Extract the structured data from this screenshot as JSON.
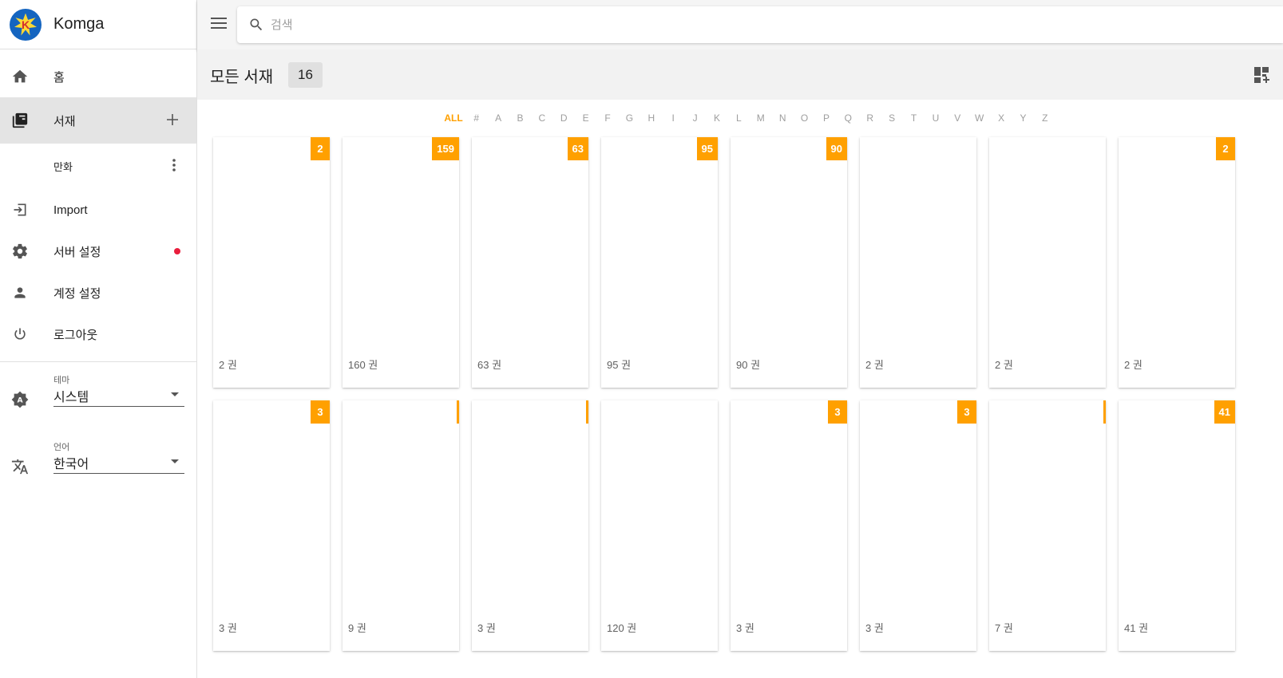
{
  "app": {
    "name": "Komga"
  },
  "nav": {
    "home": "홈",
    "libraries": "서재",
    "library_sub": "만화",
    "import": "Import",
    "server_settings": "서버 설정",
    "account_settings": "계정 설정",
    "logout": "로그아웃"
  },
  "theme": {
    "caption": "테마",
    "value": "시스템"
  },
  "language": {
    "caption": "언어",
    "value": "한국어"
  },
  "search": {
    "placeholder": "검색"
  },
  "header": {
    "title": "모든 서재",
    "count": "16"
  },
  "alphabet": [
    "ALL",
    "#",
    "A",
    "B",
    "C",
    "D",
    "E",
    "F",
    "G",
    "H",
    "I",
    "J",
    "K",
    "L",
    "M",
    "N",
    "O",
    "P",
    "Q",
    "R",
    "S",
    "T",
    "U",
    "V",
    "W",
    "X",
    "Y",
    "Z"
  ],
  "series_cards": [
    {
      "badge": "2",
      "volumes": "2 권"
    },
    {
      "badge": "159",
      "volumes": "160 권"
    },
    {
      "badge": "63",
      "volumes": "63 권"
    },
    {
      "badge": "95",
      "volumes": "95 권"
    },
    {
      "badge": "90",
      "volumes": "90 권"
    },
    {
      "badge": "",
      "volumes": "2 권"
    },
    {
      "badge": "",
      "volumes": "2 권"
    },
    {
      "badge": "2",
      "volumes": "2 권"
    },
    {
      "badge": "3",
      "volumes": "3 권"
    },
    {
      "badge": "",
      "volumes": "9 권"
    },
    {
      "badge": "",
      "volumes": "3 권"
    },
    {
      "badge": "",
      "volumes": "120 권"
    },
    {
      "badge": "3",
      "volumes": "3 권"
    },
    {
      "badge": "3",
      "volumes": "3 권"
    },
    {
      "badge": "",
      "volumes": "7 권"
    },
    {
      "badge": "41",
      "volumes": "41 권"
    }
  ],
  "colors": {
    "accent": "#ffa000",
    "notification_dot": "#e91e3d",
    "active_nav_bg": "#e4e4e4",
    "logo_blue": "#1565c0"
  }
}
